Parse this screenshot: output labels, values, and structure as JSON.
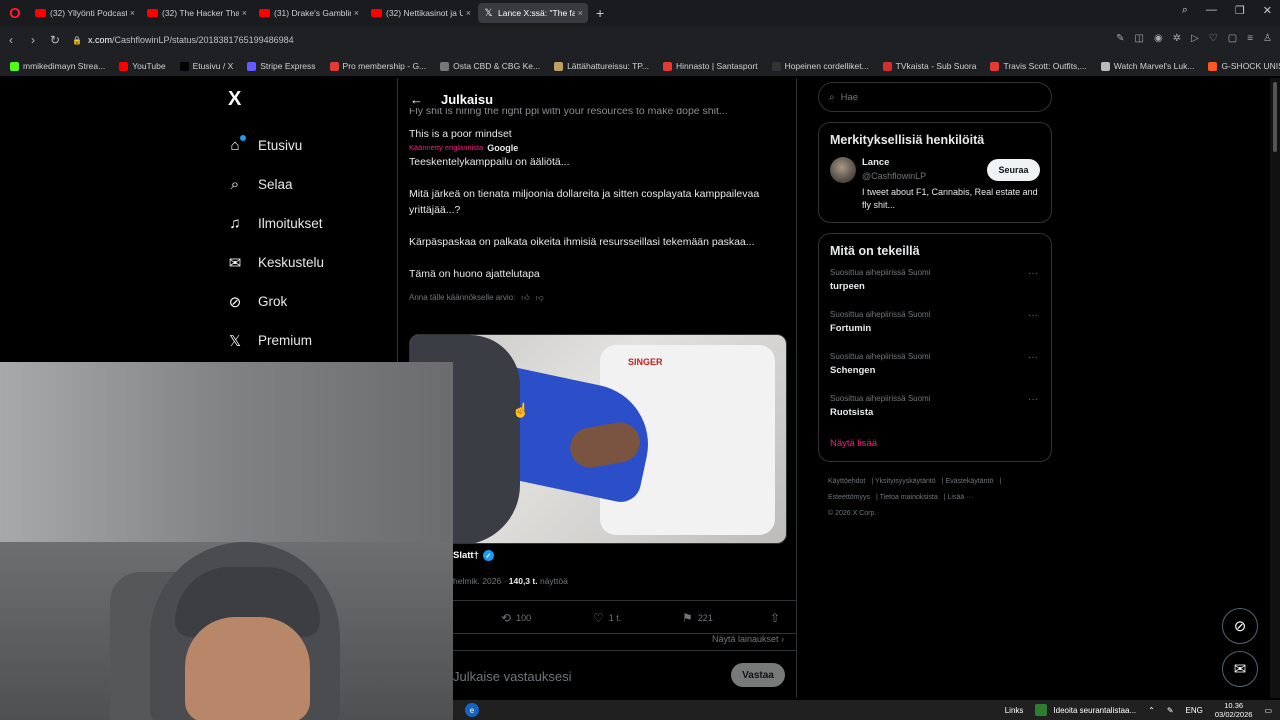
{
  "browser": {
    "tabs": [
      {
        "label": "(32) Yllyönti Podcast #52",
        "active": false,
        "icon": "youtube-icon"
      },
      {
        "label": "(32) The Hacker That Char",
        "active": false,
        "icon": "youtube-icon"
      },
      {
        "label": "(31) Drake's Gambling Ad",
        "active": false,
        "icon": "youtube-icon"
      },
      {
        "label": "(32) Nettikasinot ja Uhkap",
        "active": false,
        "icon": "youtube-icon"
      },
      {
        "label": "Lance X:ssä: \"The fak",
        "active": true,
        "icon": "x-icon"
      }
    ],
    "url_host": "x.com",
    "url_path": "/CashflowinLP/status/2018381765199486984",
    "bookmarks": [
      {
        "label": "mmikedimayn Strea...",
        "color": "#53fc18"
      },
      {
        "label": "YouTube",
        "color": "#ff0000"
      },
      {
        "label": "Etusivu / X",
        "color": "#000000"
      },
      {
        "label": "Stripe Express",
        "color": "#635bff"
      },
      {
        "label": "Pro membership - G...",
        "color": "#e53935"
      },
      {
        "label": "Osta CBD & CBG Ke...",
        "color": "#777777"
      },
      {
        "label": "Lättähattureissu: TP...",
        "color": "#c0a060"
      },
      {
        "label": "Hinnasto | Santasport",
        "color": "#e53935"
      },
      {
        "label": "Hopeinen cordelliket...",
        "color": "#333333"
      },
      {
        "label": "TVkaista - Sub Suora",
        "color": "#d32f2f"
      },
      {
        "label": "Travis Scott: Outfits,...",
        "color": "#e53935"
      },
      {
        "label": "Watch Marvel's Luk...",
        "color": "#bbbbbb"
      },
      {
        "label": "G-SHOCK UNISEX -...",
        "color": "#ff5722"
      }
    ]
  },
  "nav": {
    "logo": "X",
    "items": [
      {
        "label": "Etusivu",
        "icon": "home-icon"
      },
      {
        "label": "Selaa",
        "icon": "search-icon"
      },
      {
        "label": "Ilmoitukset",
        "icon": "bell-icon"
      },
      {
        "label": "Keskustelu",
        "icon": "mail-icon"
      },
      {
        "label": "Grok",
        "icon": "grok-icon"
      },
      {
        "label": "Premium",
        "icon": "x-premium-icon"
      }
    ]
  },
  "post": {
    "header_title": "Julkaisu",
    "cut_line": "Fly shit is hiring the right ppl with your resources to make dope shit...",
    "original_last": "This is a poor mindset",
    "translated_note": "Käännetty englannista",
    "translated_by": "Google",
    "translation": [
      "Teeskentelykamppailu on ääliötä...",
      "Mitä järkeä on tienata miljoonia dollareita ja sitten cosplayata kamppailevaa yrittäjää...?",
      "Kärpäspaskaa on palkata oikeita ihmisiä resursseillasi tekemään paskaa...",
      "Tämä on huono ajattelutapa"
    ],
    "rate_prompt": "Anna tälle käännökselle arvio:",
    "media_brand": "SINGER",
    "author_name": "Slatt†",
    "date": "helmik. 2026",
    "views": "140,3 t.",
    "views_label": "näyttöä",
    "retweets": "100",
    "likes": "1 t.",
    "bookmarks": "221",
    "show_quotes": "Näytä lainaukset",
    "reply_placeholder": "Julkaise vastauksesi",
    "reply_button": "Vastaa"
  },
  "sidebar": {
    "search_placeholder": "Hae",
    "relevant_title": "Merkityksellisiä henkilöitä",
    "person": {
      "name": "Lance",
      "handle": "@CashflowinLP",
      "bio": "I tweet about F1, Cannabis, Real estate and fly shit...",
      "follow": "Seuraa"
    },
    "trends_title": "Mitä on tekeillä",
    "trends": [
      {
        "context": "Suosittua aihepiirissä Suomi",
        "topic": "turpeen"
      },
      {
        "context": "Suosittua aihepiirissä Suomi",
        "topic": "Fortumin"
      },
      {
        "context": "Suosittua aihepiirissä Suomi",
        "topic": "Schengen"
      },
      {
        "context": "Suosittua aihepiirissä Suomi",
        "topic": "Ruotsista"
      }
    ],
    "show_more": "Näytä lisää",
    "footer_links": [
      "Käyttöehdot",
      "Yksityisyyskäytäntö",
      "Evästekäytäntö",
      "Esteettömyys",
      "Tietoa mainoksista",
      "Lisää ···"
    ],
    "copyright": "© 2026 X Corp."
  },
  "taskbar": {
    "links": "Links",
    "notification": "Ideoita seurantalistaa...",
    "lang": "ENG",
    "time": "10.36",
    "date": "03/02/2026"
  }
}
